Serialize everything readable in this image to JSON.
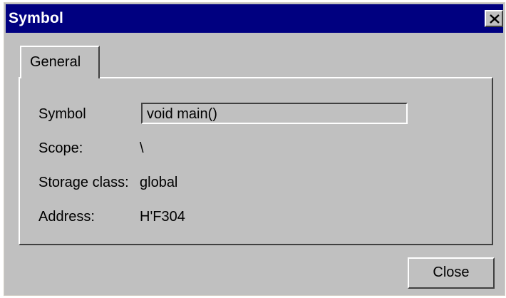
{
  "window": {
    "title": "Symbol"
  },
  "tabs": [
    {
      "label": "General",
      "active": true
    }
  ],
  "fields": {
    "symbol": {
      "label": "Symbol",
      "value": "void main()"
    },
    "scope": {
      "label": "Scope:",
      "value": "\\"
    },
    "storage_class": {
      "label": "Storage class:",
      "value": "global"
    },
    "address": {
      "label": "Address:",
      "value": "H'F304"
    }
  },
  "buttons": {
    "close_label": "Close"
  },
  "icons": {
    "title_close": "close-icon"
  },
  "colors": {
    "titlebar": "#000080",
    "dialog_bg": "#c0c0c0"
  }
}
